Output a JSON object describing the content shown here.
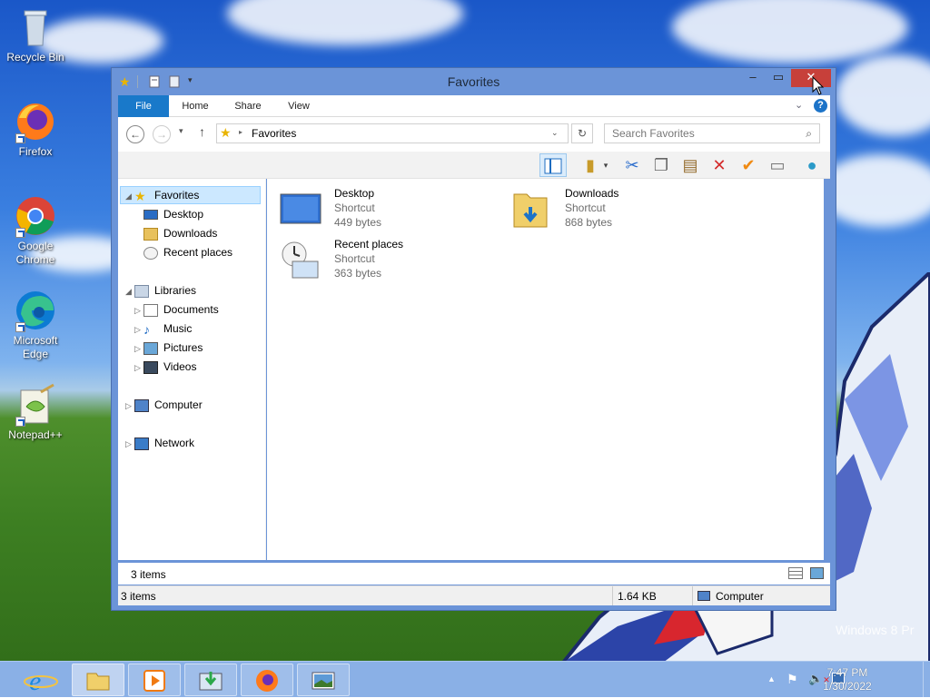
{
  "desktop": {
    "icons": [
      {
        "label": "Recycle Bin"
      },
      {
        "label": "Firefox"
      },
      {
        "label": "Google Chrome"
      },
      {
        "label": "Microsoft Edge"
      },
      {
        "label": "Notepad++"
      }
    ],
    "watermark": "Windows 8 Pr"
  },
  "window": {
    "title": "Favorites",
    "ribbon_tabs": [
      "File",
      "Home",
      "Share",
      "View"
    ],
    "address": {
      "path": "Favorites"
    },
    "search": {
      "placeholder": "Search Favorites"
    },
    "nav": {
      "favorites": "Favorites",
      "desktop": "Desktop",
      "downloads": "Downloads",
      "recent": "Recent places",
      "libraries": "Libraries",
      "documents": "Documents",
      "music": "Music",
      "pictures": "Pictures",
      "videos": "Videos",
      "computer": "Computer",
      "network": "Network"
    },
    "files": [
      {
        "name": "Desktop",
        "type": "Shortcut",
        "size": "449 bytes"
      },
      {
        "name": "Downloads",
        "type": "Shortcut",
        "size": "868 bytes"
      },
      {
        "name": "Recent places",
        "type": "Shortcut",
        "size": "363 bytes"
      }
    ],
    "item_count": "3 items",
    "status": {
      "items": "3 items",
      "size": "1.64 KB",
      "location": "Computer"
    }
  },
  "taskbar": {
    "time": "7:47 PM",
    "date": "1/30/2022"
  },
  "colors": {
    "accent": "#1979ca",
    "close": "#c7403a",
    "window_border": "#6b94d8",
    "selection": "#cce8ff"
  }
}
